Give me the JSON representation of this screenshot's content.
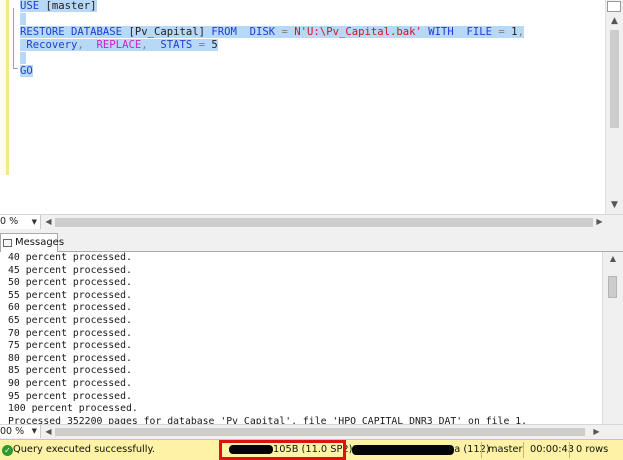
{
  "editor": {
    "lines": [
      {
        "parts": [
          {
            "t": "USE",
            "c": "kw"
          },
          {
            "t": " [master]",
            "c": "plain"
          }
        ]
      },
      {
        "parts": []
      },
      {
        "parts": [
          {
            "t": "RESTORE DATABASE",
            "c": "kw"
          },
          {
            "t": " [Pv_Capital] ",
            "c": "plain"
          },
          {
            "t": "FROM",
            "c": "kw"
          },
          {
            "t": "  DISK ",
            "c": "kw"
          },
          {
            "t": "=",
            "c": "gr"
          },
          {
            "t": " N'U:\\Pv_Capital.bak'",
            "c": "str"
          },
          {
            "t": " WITH",
            "c": "kw"
          },
          {
            "t": "  FILE ",
            "c": "kw"
          },
          {
            "t": "=",
            "c": "gr"
          },
          {
            "t": " 1",
            "c": "plain"
          },
          {
            "t": ",",
            "c": "gr"
          }
        ]
      },
      {
        "parts": [
          {
            "t": " Recovery",
            "c": "kw"
          },
          {
            "t": ",",
            "c": "gr"
          },
          {
            "t": "  REPLACE",
            "c": "fn"
          },
          {
            "t": ",",
            "c": "gr"
          },
          {
            "t": "  STATS ",
            "c": "kw"
          },
          {
            "t": "=",
            "c": "gr"
          },
          {
            "t": " 5",
            "c": "plain"
          }
        ]
      },
      {
        "parts": []
      },
      {
        "parts": [
          {
            "t": "GO",
            "c": "kw"
          }
        ]
      }
    ],
    "zoom": "0 %"
  },
  "messages_tab": {
    "label": "Messages"
  },
  "messages": [
    "40 percent processed.",
    "45 percent processed.",
    "50 percent processed.",
    "55 percent processed.",
    "60 percent processed.",
    "65 percent processed.",
    "70 percent processed.",
    "75 percent processed.",
    "80 percent processed.",
    "85 percent processed.",
    "90 percent processed.",
    "95 percent processed.",
    "100 percent processed.",
    "Processed 352200 pages for database 'Pv_Capital', file 'HPO_CAPITAL_DNR3_DAT' on file 1."
  ],
  "results_zoom": "00 %",
  "status": {
    "message": "Query executed successfully.",
    "server_version": "105B (11.0 SP2)",
    "user_suffix": "na (112)",
    "database": "master",
    "elapsed": "00:00:43",
    "rows": "0 rows"
  },
  "colors": {
    "status_bar": "#fef2a6",
    "selection": "#b8d8f8",
    "highlight_box": "#e01010"
  }
}
